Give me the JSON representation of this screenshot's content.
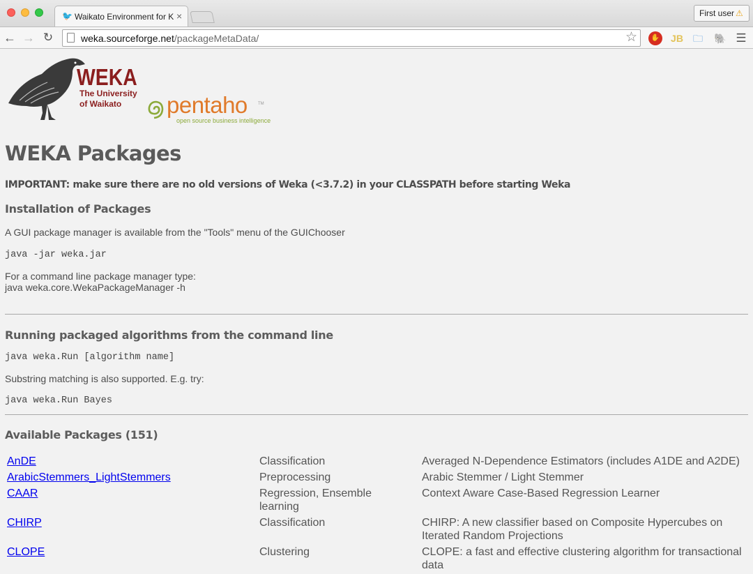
{
  "browser": {
    "tab_title": "Waikato Environment for Kr",
    "tab_close": "×",
    "user_button": "First user",
    "url_host": "weka.sourceforge.net",
    "url_path": "/packageMetaData/"
  },
  "logos": {
    "weka": "WEKA",
    "university_line1": "The University",
    "university_line2": "of Waikato",
    "pentaho": "pentaho",
    "pentaho_tm": "TM",
    "pentaho_tagline": "open source business intelligence"
  },
  "page": {
    "title": "WEKA Packages",
    "important": "IMPORTANT: make sure there are no old versions of Weka (<3.7.2) in your CLASSPATH before starting Weka",
    "install_heading": "Installation of Packages",
    "gui_text": "A GUI package manager is available from the \"Tools\" menu of the GUIChooser",
    "jar_cmd": "java -jar weka.jar",
    "cmd_line1": "For a command line package manager type:",
    "cmd_line2": "java weka.core.WekaPackageManager -h",
    "run_heading": "Running packaged algorithms from the command line",
    "run_cmd": "java weka.Run [algorithm name]",
    "substring_text": "Substring matching is also supported. E.g. try:",
    "bayes_cmd": "java weka.Run Bayes",
    "avail_heading": "Available Packages (151)"
  },
  "packages": [
    {
      "name": "AnDE",
      "category": "Classification",
      "description": "Averaged N-Dependence Estimators (includes A1DE and A2DE)"
    },
    {
      "name": "ArabicStemmers_LightStemmers",
      "category": "Preprocessing",
      "description": "Arabic Stemmer / Light Stemmer"
    },
    {
      "name": "CAAR",
      "category": "Regression, Ensemble learning",
      "description": "Context Aware Case-Based Regression Learner"
    },
    {
      "name": "CHIRP",
      "category": "Classification",
      "description": "CHIRP: A new classifier based on Composite Hypercubes on Iterated Random Projections"
    },
    {
      "name": "CLOPE",
      "category": "Clustering",
      "description": "CLOPE: a fast and effective clustering algorithm for transactional data"
    }
  ]
}
